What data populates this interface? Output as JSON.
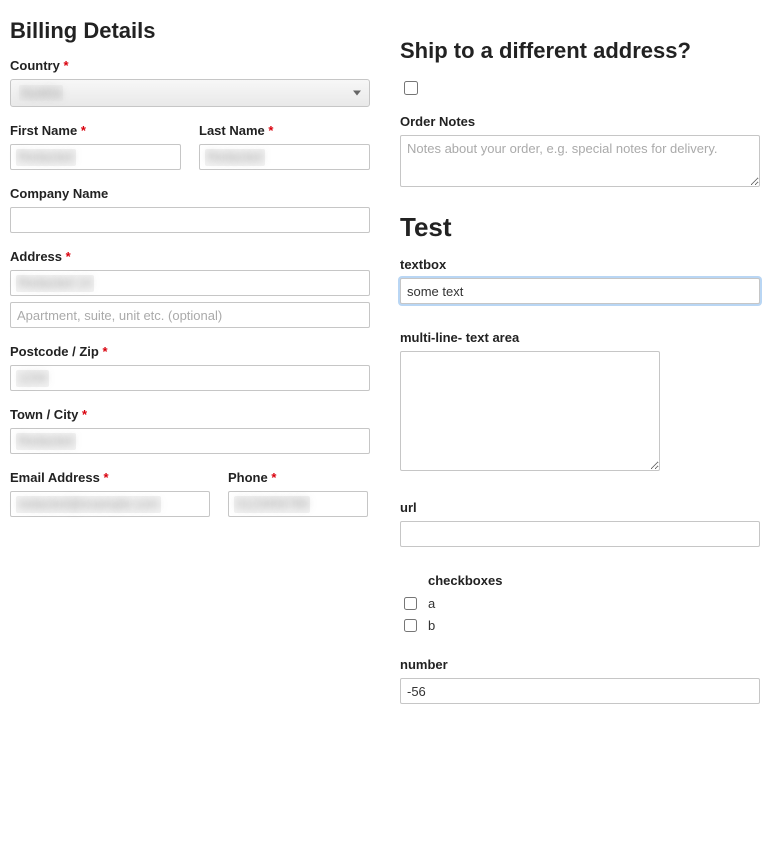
{
  "billing": {
    "heading": "Billing Details",
    "country_label": "Country",
    "country_value": "Austria",
    "first_name_label": "First Name",
    "first_name_value": "Redacted",
    "last_name_label": "Last Name",
    "last_name_value": "Redacted",
    "company_label": "Company Name",
    "company_value": "",
    "address_label": "Address",
    "address_value": "Redacted 14",
    "address2_placeholder": "Apartment, suite, unit etc. (optional)",
    "postcode_label": "Postcode / Zip",
    "postcode_value": "1234",
    "city_label": "Town / City",
    "city_value": "Redacted",
    "email_label": "Email Address",
    "email_value": "redacted@example.com",
    "phone_label": "Phone",
    "phone_value": "0123456789"
  },
  "shipping": {
    "heading": "Ship to a different address?",
    "checked": false,
    "notes_label": "Order Notes",
    "notes_placeholder": "Notes about your order, e.g. special notes for delivery.",
    "notes_value": ""
  },
  "test": {
    "heading": "Test",
    "textbox_label": "textbox",
    "textbox_value": "some text",
    "multiline_label": "multi-line- text area",
    "multiline_value": "",
    "url_label": "url",
    "url_value": "",
    "checkboxes_label": "checkboxes",
    "cb_a_label": "a",
    "cb_b_label": "b",
    "number_label": "number",
    "number_value": "-56"
  },
  "required_marker": "*"
}
